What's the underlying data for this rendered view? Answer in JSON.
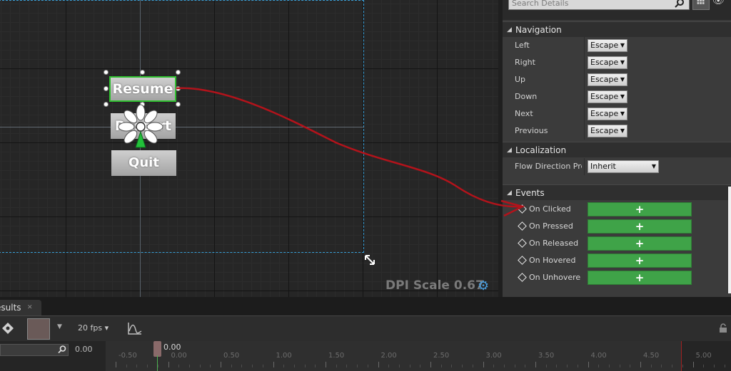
{
  "canvas": {
    "buttons": {
      "resume": "Resume",
      "restart": "Restart",
      "quit": "Quit"
    },
    "dpi_scale": "DPI Scale 0.67"
  },
  "details": {
    "search_placeholder": "Search Details",
    "sections": {
      "navigation": {
        "title": "Navigation",
        "rows": [
          {
            "label": "Left",
            "value": "Escape"
          },
          {
            "label": "Right",
            "value": "Escape"
          },
          {
            "label": "Up",
            "value": "Escape"
          },
          {
            "label": "Down",
            "value": "Escape"
          },
          {
            "label": "Next",
            "value": "Escape"
          },
          {
            "label": "Previous",
            "value": "Escape"
          }
        ]
      },
      "localization": {
        "title": "Localization",
        "rows": [
          {
            "label": "Flow Direction Pre",
            "value": "Inherit"
          }
        ]
      },
      "events": {
        "title": "Events",
        "rows": [
          {
            "label": "On Clicked",
            "add": "+"
          },
          {
            "label": "On Pressed",
            "add": "+"
          },
          {
            "label": "On Released",
            "add": "+"
          },
          {
            "label": "On Hovered",
            "add": "+"
          },
          {
            "label": "On Unhovered",
            "add": "+"
          }
        ]
      }
    }
  },
  "bottom": {
    "results_tab": "esults",
    "fps": "20 fps",
    "time_value": "0.00",
    "playhead": "0.00",
    "ticks": [
      "-0.50",
      "0.00",
      "0.50",
      "1.00",
      "1.50",
      "2.00",
      "2.50",
      "3.00",
      "3.50",
      "4.00",
      "4.50",
      "5.00"
    ]
  },
  "colors": {
    "selection": "#2fbf2f",
    "event_button": "#3fa348",
    "design_frame": "#3aa0d8",
    "annotation": "#b3131b"
  }
}
